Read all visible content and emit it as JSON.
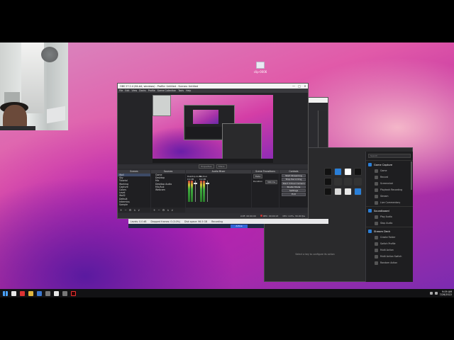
{
  "desktop": {
    "icon_label": "clip-0006"
  },
  "obs": {
    "title": "OBS 27.2.4 (64-bit, windows) - Profile: Untitled - Scenes: Untitled",
    "menu": [
      "File",
      "Edit",
      "View",
      "Docks",
      "Profile",
      "Scene Collection",
      "Tools",
      "Help"
    ],
    "window_buttons": [
      "—",
      "□",
      "✕"
    ],
    "source_label": "No source selected",
    "source_bar": [
      "Properties",
      "Filters"
    ],
    "docks": {
      "scenes": "Scenes",
      "sources": "Sources",
      "mixer": "Audio Mixer",
      "transitions": "Scene Transitions",
      "controls": "Controls"
    },
    "scenes": [
      "Wall",
      "Sky",
      "Tutorial",
      "Working",
      "Capture",
      "Colors",
      "Level",
      "Wall2",
      "Default",
      "Intermiss",
      "Sample"
    ],
    "sources": [
      "Game",
      "Desktop",
      "Mic",
      "Desktop Audio",
      "Mic/Aux",
      "Webcam"
    ],
    "mixer": [
      {
        "name": "Desktop Audio",
        "db": "0.0 dB"
      },
      {
        "name": "Mic/Aux",
        "db": "0.0 dB"
      }
    ],
    "transitions": {
      "fade": "Fade",
      "duration_label": "Duration",
      "duration": "300 ms"
    },
    "controls": [
      "Start Streaming",
      "Stop Recording",
      "Start Virtual Camera",
      "Studio Mode",
      "Settings",
      "Exit"
    ],
    "dock_footer": [
      "+",
      "−",
      "⚙",
      "∧",
      "∨"
    ],
    "status": {
      "live": "LIVE: 00:00:00",
      "rec": "REC: 00:00:13",
      "cpu": "CPU: 4.6%, 30.00 fps"
    }
  },
  "stats": {
    "left": "Levels: 0.0 dB",
    "mid": "Dropped frames: 0 (0.0%)",
    "right": "Disk space: 96.5 GB",
    "recording": "Recording",
    "active": "Active"
  },
  "streamdeck": {
    "search_placeholder": "Search",
    "sections": [
      {
        "title": "Game Capture",
        "items": [
          "Game",
          "Record",
          "Screenshot",
          "Playback Recording",
          "Stream",
          "Live Commentary"
        ]
      },
      {
        "title": "Soundboard",
        "items": [
          "Play Audio",
          "Stop Audio"
        ]
      },
      {
        "title": "Stream Deck",
        "items": [
          "Create Folder",
          "Switch Profile",
          "Multi Action",
          "Multi Action Switch",
          "Random Action"
        ]
      }
    ],
    "hint": "Select a key to configure its action"
  },
  "taskbar": {
    "time": "9:09 AM",
    "date": "7/28/2022"
  },
  "colors": {
    "obs_bg": "#2b2b2f",
    "accent": "#2f63d6",
    "record_red": "#dd3333"
  }
}
